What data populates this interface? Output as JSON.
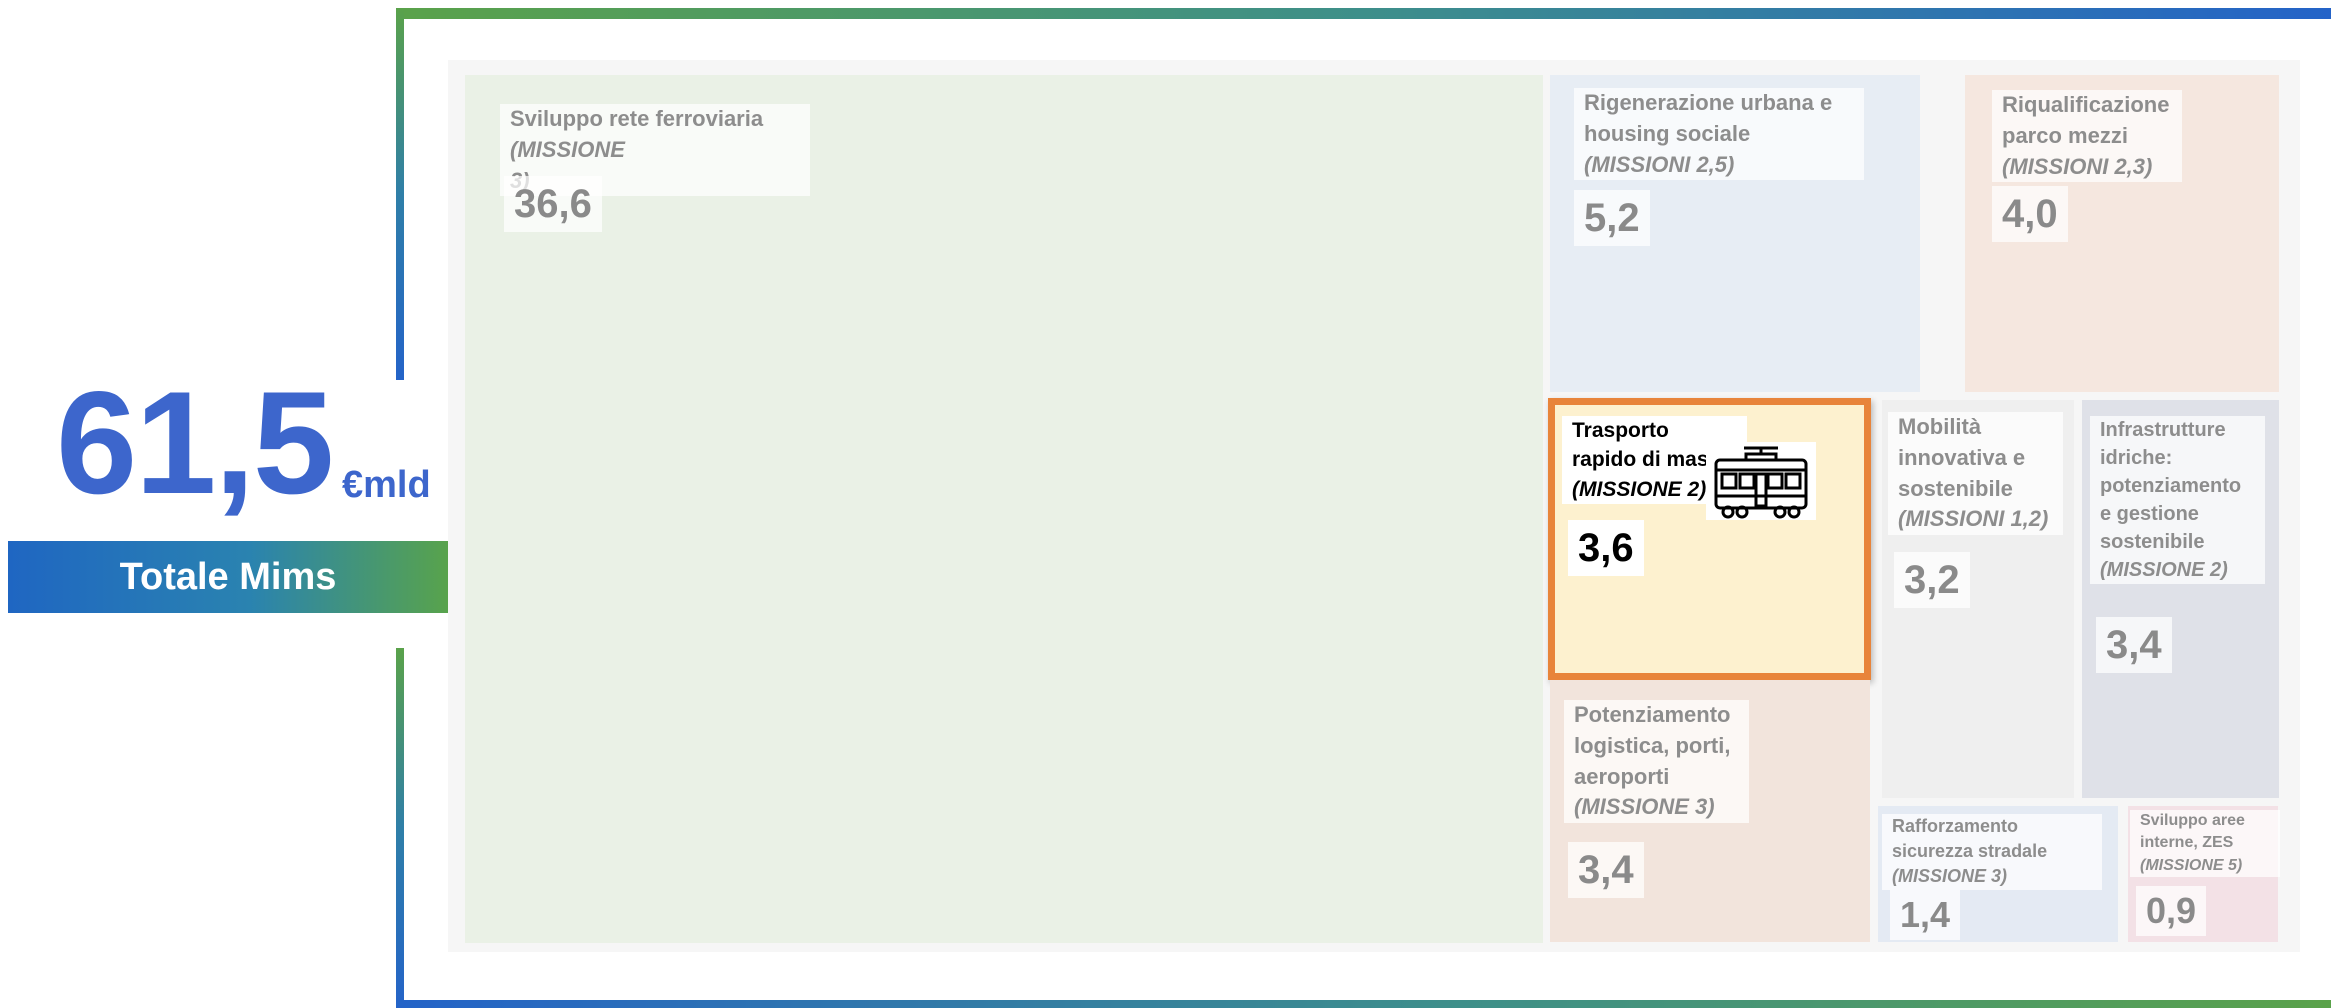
{
  "total": {
    "value": "61,5",
    "unit": "€mld",
    "label": "Totale Mims"
  },
  "chart_data": {
    "type": "treemap",
    "items": [
      {
        "name": "Sviluppo rete ferroviaria",
        "mission": "(MISSIONE 3)",
        "value": 36.6,
        "value_label": "36,6",
        "color": "#eaf1e6"
      },
      {
        "name": "Rigenerazione urbana e housing sociale",
        "mission": "(MISSIONI 2,5)",
        "value": 5.2,
        "value_label": "5,2",
        "color": "#e7edf4"
      },
      {
        "name": "Riqualificazione parco mezzi",
        "mission": "(MISSIONI 2,3)",
        "value": 4.0,
        "value_label": "4,0",
        "color": "#f5e7df"
      },
      {
        "name": "Trasporto rapido di massa",
        "mission": "(MISSIONE 2)",
        "value": 3.6,
        "value_label": "3,6",
        "color": "#fdf1cf",
        "highlight": true,
        "icon": "tram-icon"
      },
      {
        "name": "Mobilità innovativa e sostenibile",
        "mission": "(MISSIONI 1,2)",
        "value": 3.2,
        "value_label": "3,2",
        "color": "#efefef"
      },
      {
        "name": "Infrastrutture idriche: potenziamento e gestione sostenibile",
        "mission": "(MISSIONE 2)",
        "value": 3.4,
        "value_label": "3,4",
        "color": "#dfe1e8"
      },
      {
        "name": "Potenziamento logistica, porti, aeroporti",
        "mission": "(MISSIONE 3)",
        "value": 3.4,
        "value_label": "3,4",
        "color": "#f2e4dc"
      },
      {
        "name": "Rafforzamento sicurezza stradale",
        "mission": "(MISSIONE 3)",
        "value": 1.4,
        "value_label": "1,4",
        "color": "#e4eaf3"
      },
      {
        "name": "Sviluppo aree interne, ZES",
        "mission": "(MISSIONE 5)",
        "value": 0.9,
        "value_label": "0,9",
        "color": "#f3e1e6"
      }
    ],
    "colors": {
      "frame_green": "#5aa24a",
      "frame_blue": "#2463c8",
      "highlight_border": "#e8843a",
      "total_text": "#3d66cc"
    }
  }
}
